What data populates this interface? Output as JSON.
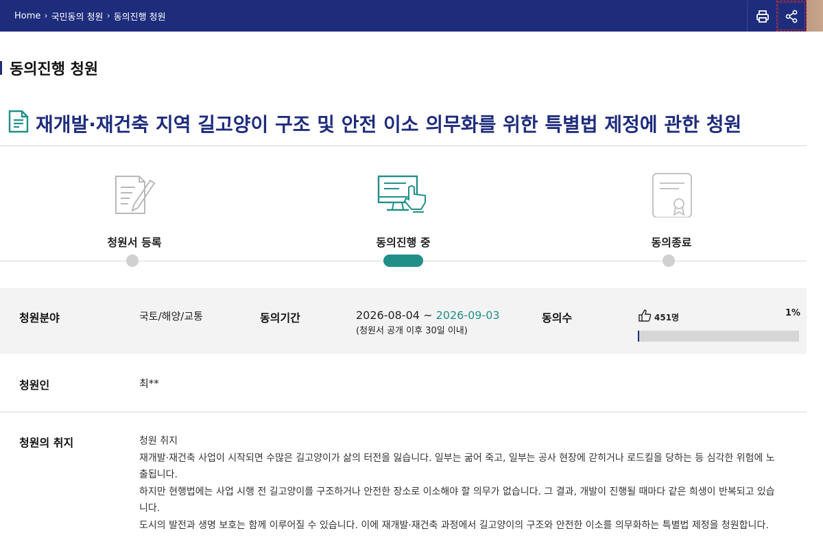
{
  "breadcrumb": {
    "items": [
      "Home",
      "국민동의 청원",
      "동의진행 청원"
    ],
    "separator": "›"
  },
  "toolbar": {
    "print_icon": "printer-icon",
    "share_icon": "share-icon"
  },
  "page_title": "동의진행 청원",
  "petition": {
    "title": "재개발·재건축 지역 길고양이 구조 및 안전 이소 의무화를 위한 특별법 제정에 관한 청원"
  },
  "steps": [
    {
      "label": "청원서 등록",
      "icon": "edit-document-icon",
      "state": "done"
    },
    {
      "label": "동의진행 중",
      "icon": "monitor-touch-icon",
      "state": "active"
    },
    {
      "label": "동의종료",
      "icon": "certificate-icon",
      "state": "pending"
    }
  ],
  "info": {
    "field_label": "청원분야",
    "field_value": "국토/해양/교통",
    "period_label": "동의기간",
    "period_start": "2026-08-04",
    "period_sep": "~",
    "period_end": "2026-09-03",
    "period_note": "(청원서 공개 이후 30일 이내)",
    "agree_label": "동의수",
    "agree_count": "451명",
    "agree_percent": "1%",
    "agree_fraction": 0.01,
    "petitioner_label": "청원인",
    "petitioner_value": "최**",
    "purpose_label": "청원의 취지"
  },
  "purpose": {
    "heading": "청원 취지",
    "lines": [
      "재개발·재건축 사업이 시작되면 수많은 길고양이가 삶의 터전을 잃습니다. 일부는 굶어 죽고, 일부는 공사 현장에 갇히거나 로드킬을 당하는 등 심각한 위험에 노",
      "출됩니다.",
      "하지만 현행법에는 사업 시행 전 길고양이를 구조하거나 안전한 장소로 이소해야 할 의무가 없습니다. 그 결과, 개발이 진행될 때마다 같은 희생이 반복되고 있습",
      "니다.",
      "도시의 발전과 생명 보호는 함께 이루어질 수 있습니다. 이에 재개발·재건축 과정에서 길고양이의 구조와 안전한 이소를 의무화하는 특별법 제정을 청원합니다."
    ]
  },
  "colors": {
    "navy": "#1e2c7c",
    "teal": "#1f8f88"
  }
}
